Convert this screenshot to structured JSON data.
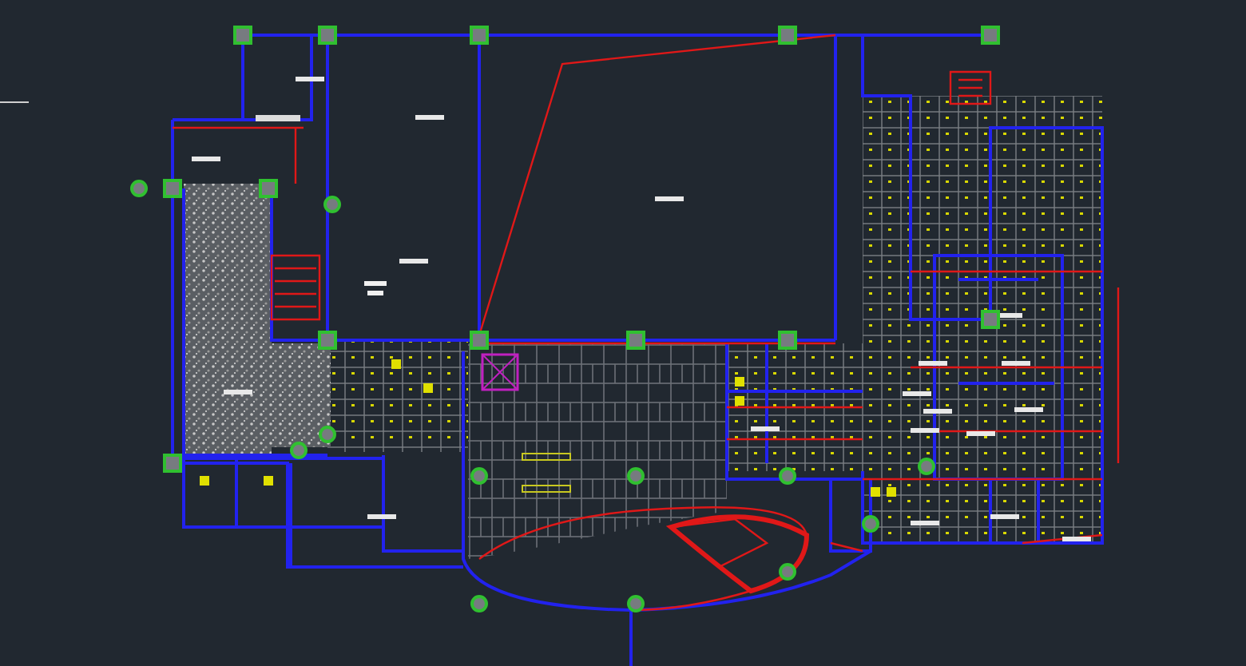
{
  "viewport": {
    "kind": "floor-plan"
  }
}
